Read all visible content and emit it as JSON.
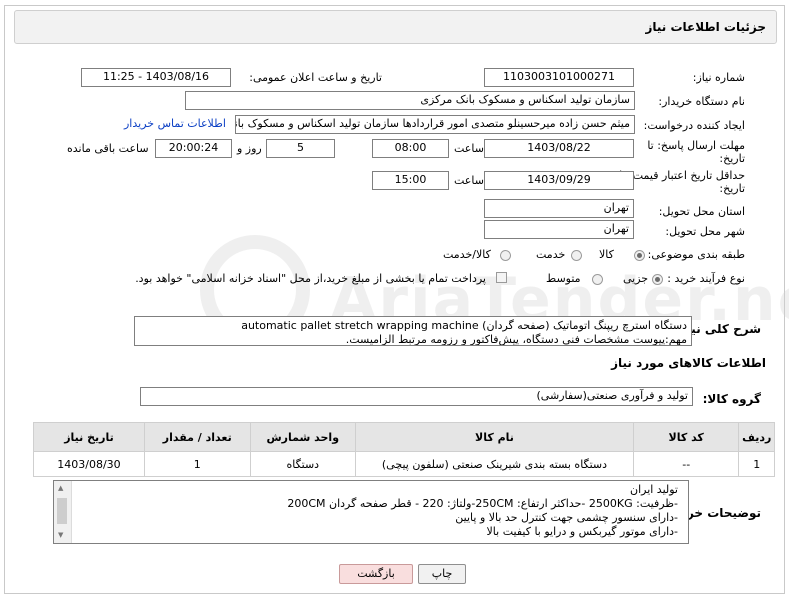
{
  "header": {
    "title": "جزئیات اطلاعات نیاز"
  },
  "form": {
    "need_number": {
      "label": "شماره نیاز:",
      "value": "1103003101000271"
    },
    "announce": {
      "label": "تاریخ و ساعت اعلان عمومی:",
      "value": "1403/08/16 - 11:25"
    },
    "buyer_org": {
      "label": "نام دستگاه خریدار:",
      "value": "سازمان تولید اسکناس و مسکوک بانک مرکزی"
    },
    "requester": {
      "label": "ایجاد کننده درخواست:",
      "value": "میثم حسن زاده میرحسینلو متصدی امور قراردادها سازمان تولید اسکناس و مسکوک بانک مرکزی",
      "contact_link": "اطلاعات تماس خریدار"
    },
    "reply_deadline": {
      "label_line1": "مهلت ارسال پاسخ: تا",
      "label_line2": "تاریخ:",
      "date": "1403/08/22",
      "time_label": "ساعت",
      "time": "08:00",
      "days": "5",
      "days_label": "روز و",
      "remaining": "20:00:24",
      "remaining_label": "ساعت باقی مانده"
    },
    "price_validity": {
      "label_line1": "حداقل تاریخ اعتبار قیمت: تا",
      "label_line2": "تاریخ:",
      "date": "1403/09/29",
      "time_label": "ساعت",
      "time": "15:00"
    },
    "delivery_province": {
      "label": "استان محل تحویل:",
      "value": "تهران"
    },
    "delivery_city": {
      "label": "شهر محل تحویل:",
      "value": "تهران"
    },
    "category": {
      "label": "طبقه بندی موضوعی:",
      "options": [
        "کالا",
        "خدمت",
        "کالا/خدمت"
      ],
      "selected": "کالا"
    },
    "purchase_type": {
      "label": "نوع فرآیند خرید :",
      "options": [
        "جزیی",
        "متوسط"
      ],
      "selected": "جزیی",
      "note": "پرداخت تمام یا بخشی از مبلغ خرید،از محل \"اسناد خزانه اسلامی\" خواهد بود."
    }
  },
  "description": {
    "label": "شرح کلی نیاز:",
    "line1": "دستگاه استرچ ریپنگ اتوماتیک (صفحه گردان)  automatic pallet stretch wrapping machine",
    "line2": "مهم:پیوست مشخصات فنی دستگاه، پیش‌فاکتور و رزومه مرتبط الزامیست."
  },
  "goods_section": {
    "title": "اطلاعات کالاهای مورد نیاز"
  },
  "goods_group": {
    "label": "گروه کالا:",
    "value": "تولید و فرآوری صنعتی(سفارشی)"
  },
  "table": {
    "headers": [
      "ردیف",
      "کد کالا",
      "نام کالا",
      "واحد شمارش",
      "تعداد / مقدار",
      "تاریخ نیاز"
    ],
    "rows": [
      [
        "1",
        "--",
        "دستگاه بسته بندی شیرینک صنعتی (سلفون پیچی)",
        "دستگاه",
        "1",
        "1403/08/30"
      ]
    ]
  },
  "buyer_notes": {
    "label": "توضیحات خریدار:",
    "lines": [
      "تولید ایران",
      "-ظرفیت: 2500KG -حداکثر ارتفاع: 250CM-ولتاژ: 220 - قطر صفحه گردان 200CM",
      "-دارای سنسور چشمی جهت کنترل حد بالا و پایین",
      "-دارای موتور گیربکس و درایو با کیفیت بالا"
    ]
  },
  "buttons": {
    "print": "چاپ",
    "back": "بازگشت"
  },
  "watermark": {
    "text": "AriaTender.neT"
  }
}
